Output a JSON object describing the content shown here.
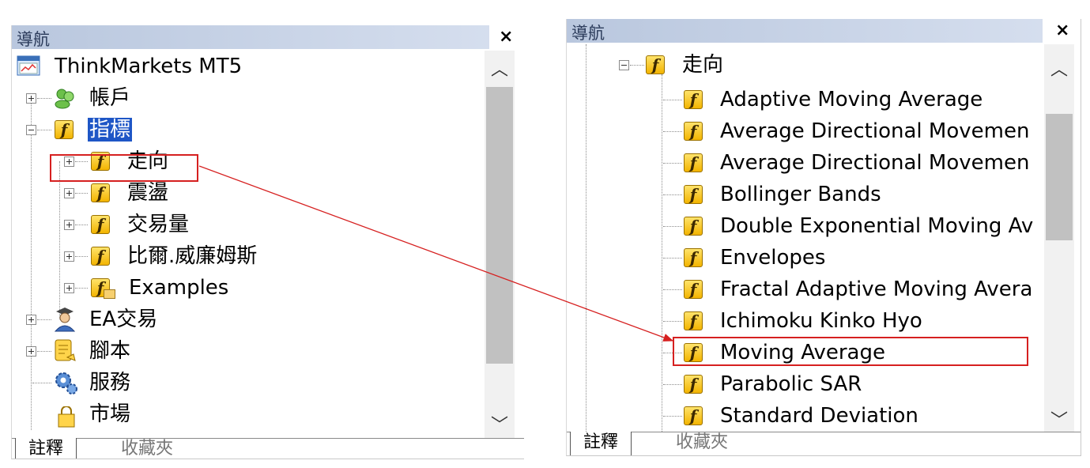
{
  "left_panel": {
    "title": "導航",
    "close": "×",
    "root": "ThinkMarkets MT5",
    "items": [
      {
        "label": "帳戶",
        "icon": "accounts-icon"
      },
      {
        "label": "指標",
        "icon": "indicator-icon"
      },
      {
        "label": "走向",
        "icon": "indicator-icon"
      },
      {
        "label": "震盪",
        "icon": "indicator-icon"
      },
      {
        "label": "交易量",
        "icon": "indicator-icon"
      },
      {
        "label": "比爾.威廉姆斯",
        "icon": "indicator-icon"
      },
      {
        "label": "Examples",
        "icon": "indicator-folder-icon"
      },
      {
        "label": "EA交易",
        "icon": "expert-advisor-icon"
      },
      {
        "label": "腳本",
        "icon": "script-icon"
      },
      {
        "label": "服務",
        "icon": "service-icon"
      },
      {
        "label": "市場",
        "icon": "market-icon"
      }
    ],
    "tabs": [
      "註釋",
      "收藏夾"
    ]
  },
  "right_panel": {
    "title": "導航",
    "close": "×",
    "parent": "走向",
    "items": [
      "Adaptive Moving Average",
      "Average Directional Movemen",
      "Average Directional Movemen",
      "Bollinger Bands",
      "Double Exponential Moving Av",
      "Envelopes",
      "Fractal Adaptive Moving Avera",
      "Ichimoku Kinko Hyo",
      "Moving Average",
      "Parabolic SAR",
      "Standard Deviation"
    ],
    "tabs": [
      "註釋",
      "收藏夾"
    ]
  },
  "colors": {
    "highlight": "#d62020",
    "selection": "#1e56c6",
    "title_bar": "#c4d0e6"
  }
}
